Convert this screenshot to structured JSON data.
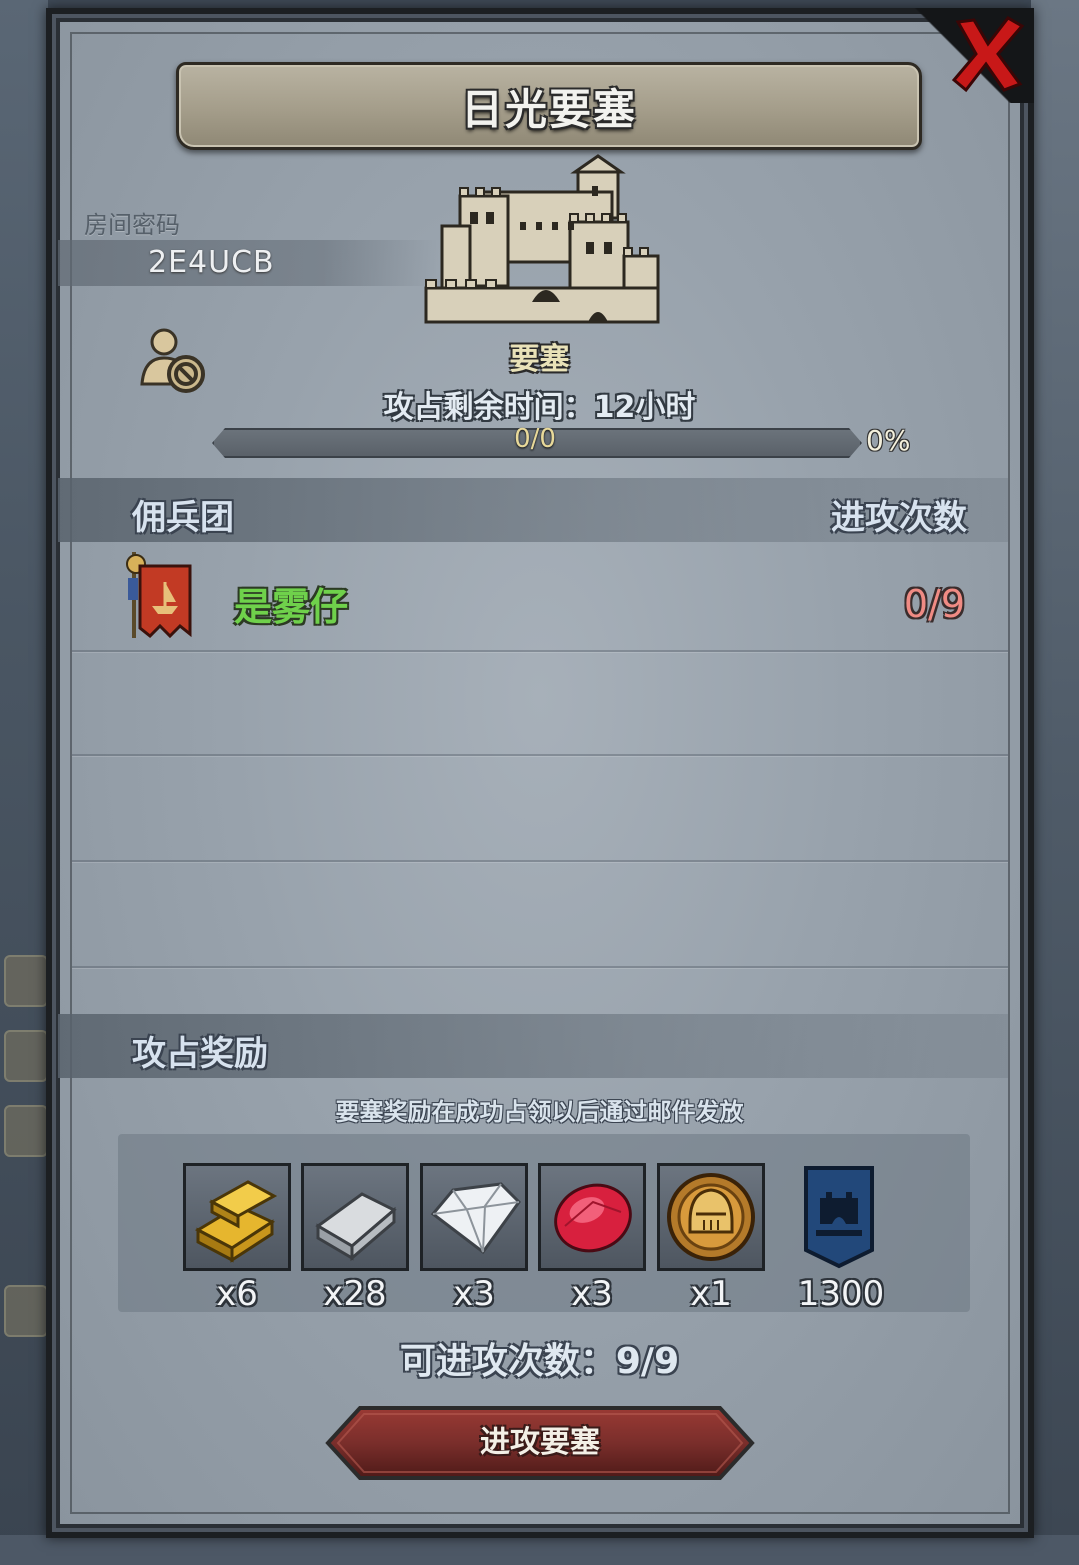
{
  "dialog": {
    "title": "日光要塞",
    "close_icon": "close-x-icon"
  },
  "room": {
    "label": "房间密码",
    "code": "2E4UCB"
  },
  "fortress": {
    "label": "要塞",
    "occupy_time_text": "攻占剩余时间：12小时",
    "progress_text": "0/0",
    "progress_percent": "0%",
    "progress_value": 0
  },
  "mercenary_section": {
    "title": "佣兵团",
    "attack_count_header": "进攻次数",
    "rows": [
      {
        "name": "是雾仔",
        "attacks": "0/9"
      }
    ]
  },
  "reward_section": {
    "title": "攻占奖励",
    "note": "要塞奖励在成功占领以后通过邮件发放",
    "items": [
      {
        "icon": "gold-bars-icon",
        "count": "x6"
      },
      {
        "icon": "iron-ingot-icon",
        "count": "x28"
      },
      {
        "icon": "diamond-icon",
        "count": "x3"
      },
      {
        "icon": "ruby-icon",
        "count": "x3"
      },
      {
        "icon": "knight-helmet-coin-icon",
        "count": "x1"
      },
      {
        "icon": "fortress-badge-icon",
        "count": "1300"
      }
    ]
  },
  "attempts_text": "可进攻次数：9/9",
  "attack_button": {
    "label": "进攻要塞"
  },
  "colors": {
    "ally_name": "#6fd14b",
    "attack_count": "#f08b84",
    "button": "#7a2e2b"
  }
}
